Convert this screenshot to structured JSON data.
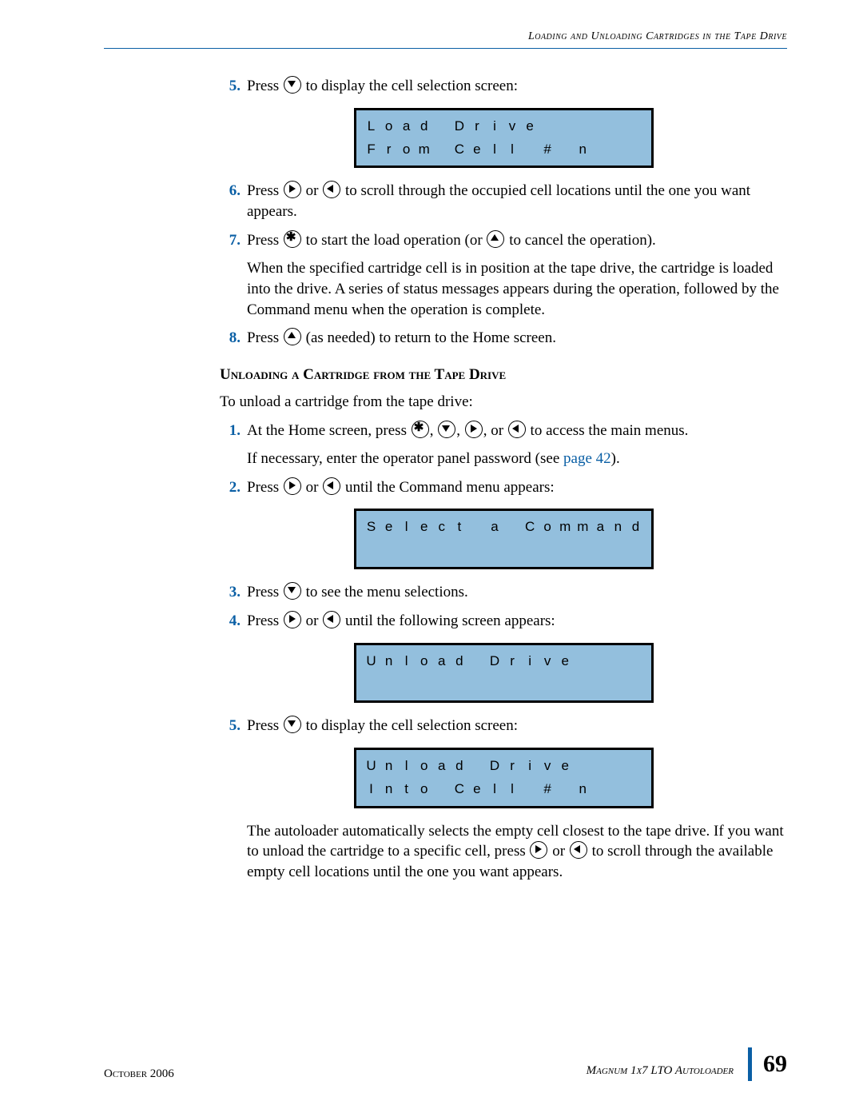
{
  "header": "Loading and Unloading Cartridges in the Tape Drive",
  "steps_a": {
    "s5_num": "5.",
    "s5_a": "Press ",
    "s5_b": " to display the cell selection screen:",
    "s6_num": "6.",
    "s6_a": "Press ",
    "s6_b": " or ",
    "s6_c": " to scroll through the occupied cell locations until the one you want appears.",
    "s7_num": "7.",
    "s7_a": "Press ",
    "s7_b": " to start the load operation (or ",
    "s7_c": " to cancel the operation).",
    "s7_p": "When the specified cartridge cell is in position at the tape drive, the cartridge is loaded into the drive. A series of status messages appears during the operation, followed by the Command menu when the operation is complete.",
    "s8_num": "8.",
    "s8_a": "Press ",
    "s8_b": " (as needed) to return to the Home screen."
  },
  "lcd1": {
    "l1": "Load Drive",
    "l2": "From Cell # n"
  },
  "section_title": "Unloading a Cartridge from the Tape Drive",
  "intro": "To unload a cartridge from the tape drive:",
  "steps_b": {
    "s1_num": "1.",
    "s1_a": "At the Home screen, press ",
    "s1_c": ", ",
    "s1_e": " to access the main menus.",
    "s1_or": ", or ",
    "s1_p_a": "If necessary, enter the operator panel password (see ",
    "s1_link": "page 42",
    "s1_p_b": ").",
    "s2_num": "2.",
    "s2_a": "Press ",
    "s2_b": " or ",
    "s2_c": " until the Command menu appears:",
    "s3_num": "3.",
    "s3_a": "Press ",
    "s3_b": " to see the menu selections.",
    "s4_num": "4.",
    "s4_a": "Press ",
    "s4_b": " or ",
    "s4_c": " until the following screen appears:",
    "s5_num": "5.",
    "s5_a": "Press ",
    "s5_b": " to display the cell selection screen:",
    "end_a": "The autoloader automatically selects the empty cell closest to the tape drive. If you want to unload the cartridge to a specific cell, press ",
    "end_b": " or ",
    "end_c": " to scroll through the available empty cell locations until the one you want appears."
  },
  "lcd2": {
    "l1": "Select a Command"
  },
  "lcd3": {
    "l1": "Unload Drive"
  },
  "lcd4": {
    "l1": "Unload Drive",
    "l2": "Into Cell # n"
  },
  "footer": {
    "date": "October 2006",
    "product": "Magnum 1x7 LTO Autoloader",
    "page": "69"
  }
}
